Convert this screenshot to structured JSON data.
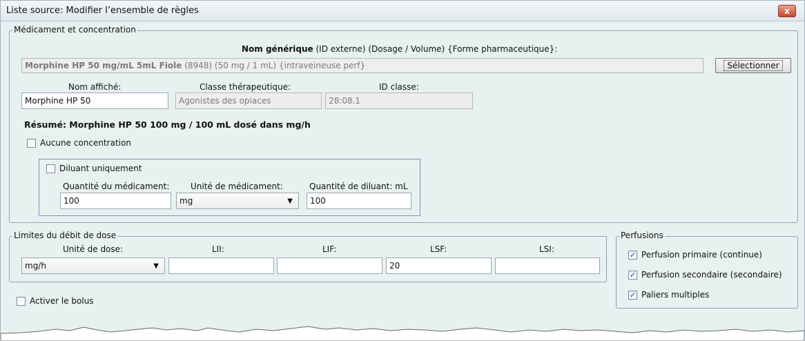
{
  "window": {
    "title": "Liste source: Modifier l’ensemble de règles",
    "close_label": "x"
  },
  "med_group": {
    "legend": "Médicament et concentration",
    "header_bold": "Nom générique",
    "header_rest": " (ID externe) (Dosage / Volume) {Forme pharmaceutique}:",
    "generic_bold": "Morphine HP 50 mg/mL 5mL Fiole",
    "generic_rest": " (8948) (50 mg / 1 mL) {intraveineuse perf}",
    "select_label": "Sélectionner",
    "display_name_label": "Nom affiché:",
    "display_name_value": "Morphine HP  50",
    "therapeutic_class_label": "Classe thérapeutique:",
    "therapeutic_class_value": "Agonistes des opiaces",
    "class_id_label": "ID classe:",
    "class_id_value": "28:08.1",
    "summary": "Résumé: Morphine HP  50 100 mg / 100 mL dosé dans mg/h",
    "no_concentration_label": "Aucune concentration",
    "no_concentration_checked": false,
    "diluent_only_label": "Diluant uniquement",
    "diluent_only_checked": false,
    "drug_amount_label": "Quantité du médicament:",
    "drug_amount_value": "100",
    "drug_unit_label": "Unité de médicament:",
    "drug_unit_value": "mg",
    "diluent_amount_label": "Quantité de diluant: mL",
    "diluent_amount_value": "100"
  },
  "dose_group": {
    "legend": "Limites du débit de dose",
    "dose_unit_label": "Unité de dose:",
    "dose_unit_value": "mg/h",
    "lii_label": "LII:",
    "lii_value": "",
    "lif_label": "LIF:",
    "lif_value": "",
    "lsf_label": "LSF:",
    "lsf_value": "20",
    "lsi_label": "LSI:",
    "lsi_value": ""
  },
  "bolus": {
    "label": "Activer le bolus",
    "checked": false
  },
  "perfusions": {
    "legend": "Perfusions",
    "items": [
      {
        "label": "Perfusion primaire (continue)",
        "checked": true
      },
      {
        "label": "Perfusion secondaire (secondaire)",
        "checked": true
      },
      {
        "label": "Paliers multiples",
        "checked": true
      }
    ]
  },
  "icons": {
    "dropdown": "chevron-down-icon",
    "check": "checkmark-icon",
    "close": "close-icon"
  }
}
